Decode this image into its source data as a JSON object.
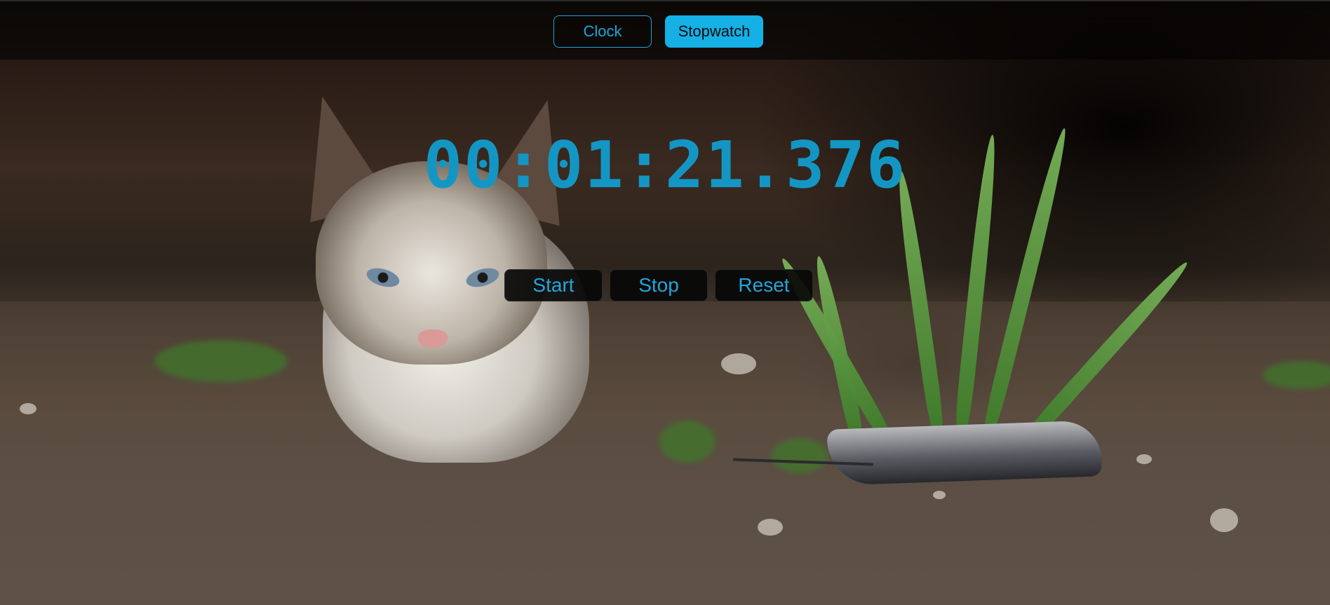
{
  "nav": {
    "clock_label": "Clock",
    "stopwatch_label": "Stopwatch",
    "active_tab": "Stopwatch"
  },
  "stopwatch": {
    "time": "00:01:21.376"
  },
  "controls": {
    "start_label": "Start",
    "stop_label": "Stop",
    "reset_label": "Reset"
  },
  "colors": {
    "accent": "#14b0e6",
    "time_text": "#1496c4"
  }
}
